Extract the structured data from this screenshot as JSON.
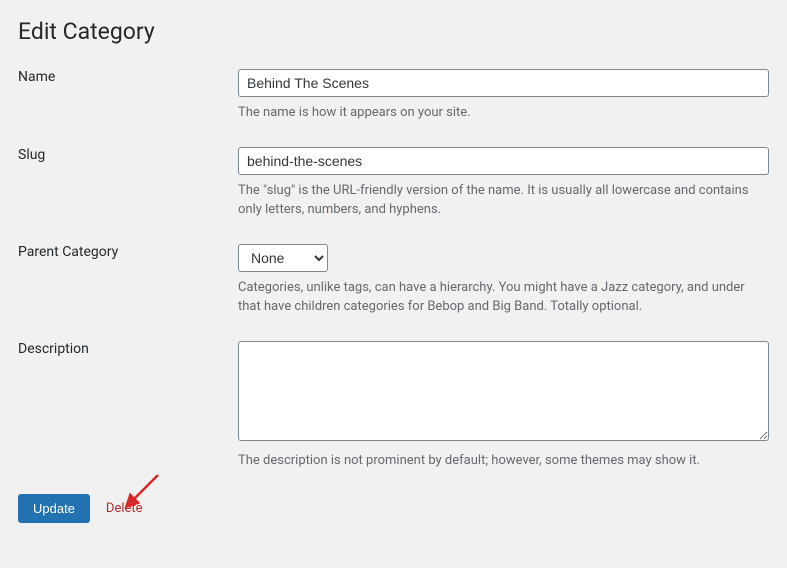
{
  "page_title": "Edit Category",
  "form": {
    "name": {
      "label": "Name",
      "value": "Behind The Scenes",
      "help": "The name is how it appears on your site."
    },
    "slug": {
      "label": "Slug",
      "value": "behind-the-scenes",
      "help": "The \"slug\" is the URL-friendly version of the name. It is usually all lowercase and contains only letters, numbers, and hyphens."
    },
    "parent": {
      "label": "Parent Category",
      "selected": "None",
      "help": "Categories, unlike tags, can have a hierarchy. You might have a Jazz category, and under that have children categories for Bebop and Big Band. Totally optional."
    },
    "description": {
      "label": "Description",
      "value": "",
      "help": "The description is not prominent by default; however, some themes may show it."
    }
  },
  "actions": {
    "update_label": "Update",
    "delete_label": "Delete"
  },
  "annotation": {
    "arrow_color": "#d92626"
  }
}
